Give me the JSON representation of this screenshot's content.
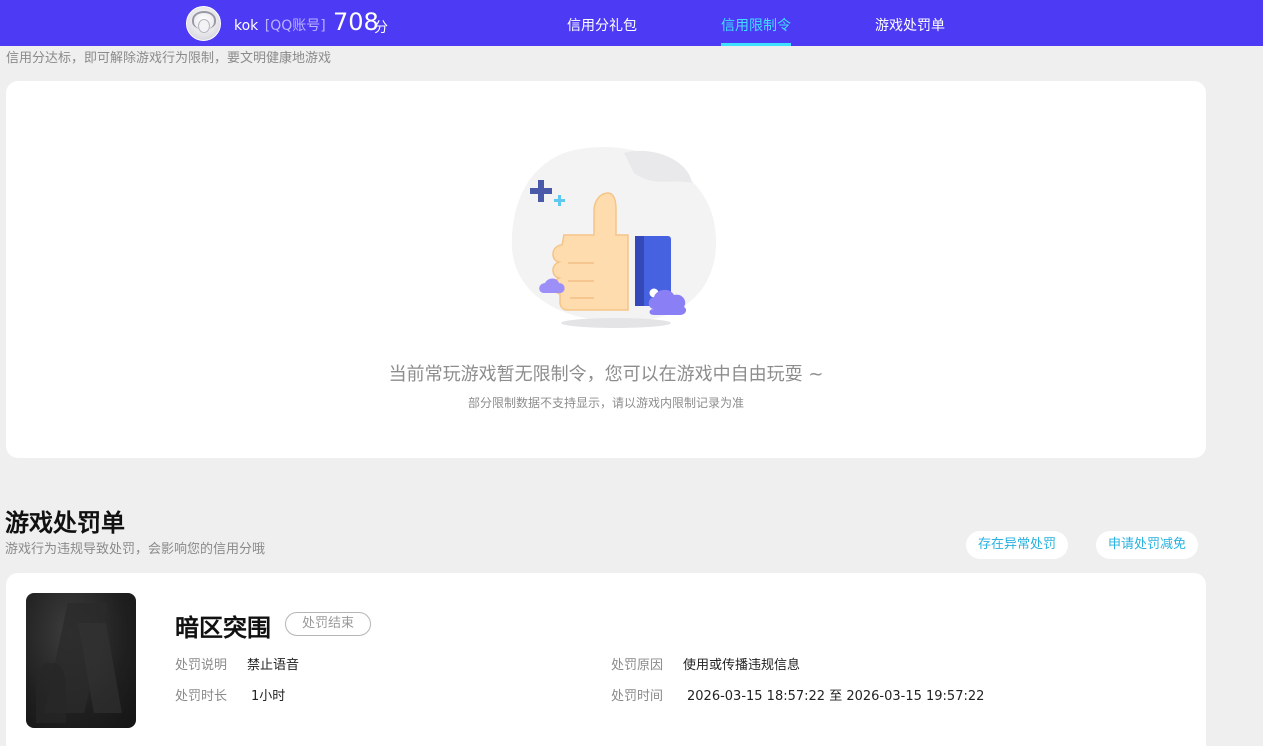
{
  "header": {
    "username": "kok",
    "account_type": "[QQ账号]",
    "score": "708",
    "score_unit": "分",
    "nav": [
      "信用分礼包",
      "信用限制令",
      "游戏处罚单"
    ],
    "active_nav": "信用限制令",
    "colors": {
      "bar": "#4d3af5",
      "active": "#3ee1ff"
    }
  },
  "page": {
    "subtitle": "信用分达标，即可解除游戏行为限制，要文明健康地游戏"
  },
  "empty_state": {
    "message": "当前常玩游戏暂无限制令，您可以在游戏中自由玩耍 ~",
    "note": "部分限制数据不支持显示，请以游戏内限制记录为准",
    "icon": "thumbs-up-illustration"
  },
  "punishments": {
    "title": "游戏处罚单",
    "desc": "游戏行为违规导致处罚，会影响您的信用分哦",
    "actions": [
      "存在异常处罚",
      "申请处罚减免"
    ],
    "items": [
      {
        "game": "暗区突围",
        "status": "处罚结束",
        "desc_label": "处罚说明",
        "desc_value": "禁止语音",
        "duration_label": "处罚时长",
        "duration_value": "1小时",
        "reason_label": "处罚原因",
        "reason_value": "使用或传播违规信息",
        "time_label": "处罚时间",
        "time_value": "2026-03-15 18:57:22 至 2026-03-15 19:57:22"
      }
    ]
  }
}
